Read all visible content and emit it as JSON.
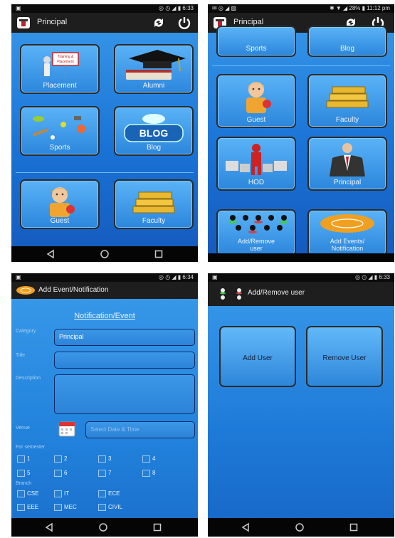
{
  "screen1": {
    "status_left": "▣",
    "status_right": "◎ ◷ ◢ ▮ 6:33",
    "title": "Principal",
    "tiles": [
      {
        "label": "Placement",
        "icon": "training-sign-icon",
        "sign_text": "Training & Placement"
      },
      {
        "label": "Alumni",
        "icon": "graduation-cap-icon"
      },
      {
        "label": "Sports",
        "icon": "sports-equipment-icon"
      },
      {
        "label": "Blog",
        "icon": "blog-bubble-icon",
        "badge": "BLOG"
      },
      {
        "label": "Guest",
        "icon": "guest-person-icon"
      },
      {
        "label": "Faculty",
        "icon": "books-stack-icon"
      }
    ]
  },
  "screen2": {
    "status_left": "✉ ◎ ◢ ▨",
    "status_right": "✱ ▼ ◢ 28% ▮ 11:12 pm",
    "title": "Principal",
    "tiles": [
      {
        "label": "Sports"
      },
      {
        "label": "Blog"
      },
      {
        "label": "Guest",
        "icon": "guest-person-icon"
      },
      {
        "label": "Faculty",
        "icon": "books-stack-icon"
      },
      {
        "label": "HOD",
        "icon": "hod-figure-icon"
      },
      {
        "label": "Principal",
        "icon": "suit-person-icon"
      },
      {
        "label": "Add/Remove user",
        "icon": "users-group-icon"
      },
      {
        "label": "Add Events/ Notification",
        "icon": "event-oval-icon"
      }
    ]
  },
  "screen3": {
    "status_left": "▣",
    "status_right": "◎ ◷ ◢ ▮ 6:34",
    "title": "Add Event/Notification",
    "heading": "Notification/Event",
    "labels": {
      "category": "Category",
      "title": "Title",
      "description": "Description",
      "venue": "Venue",
      "semester": "For semester",
      "branch": "Branch"
    },
    "category_value": "Principal",
    "title_value": "",
    "description_value": "",
    "date_placeholder": "Select Date & Time",
    "semesters": [
      "1",
      "2",
      "3",
      "4",
      "5",
      "6",
      "7",
      "8"
    ],
    "branches": [
      "CSE",
      "IT",
      "ECE",
      "EEE",
      "MEC",
      "CIVIL"
    ]
  },
  "screen4": {
    "status_left": "▣",
    "status_right": "◎ ◷ ◢ ▮ 6:33",
    "title": "Add/Remove user",
    "add_label": "Add User",
    "remove_label": "Remove User"
  },
  "colors": {
    "accent": "#1a73d6",
    "bar": "#1e1e1e",
    "nav": "#050505"
  }
}
